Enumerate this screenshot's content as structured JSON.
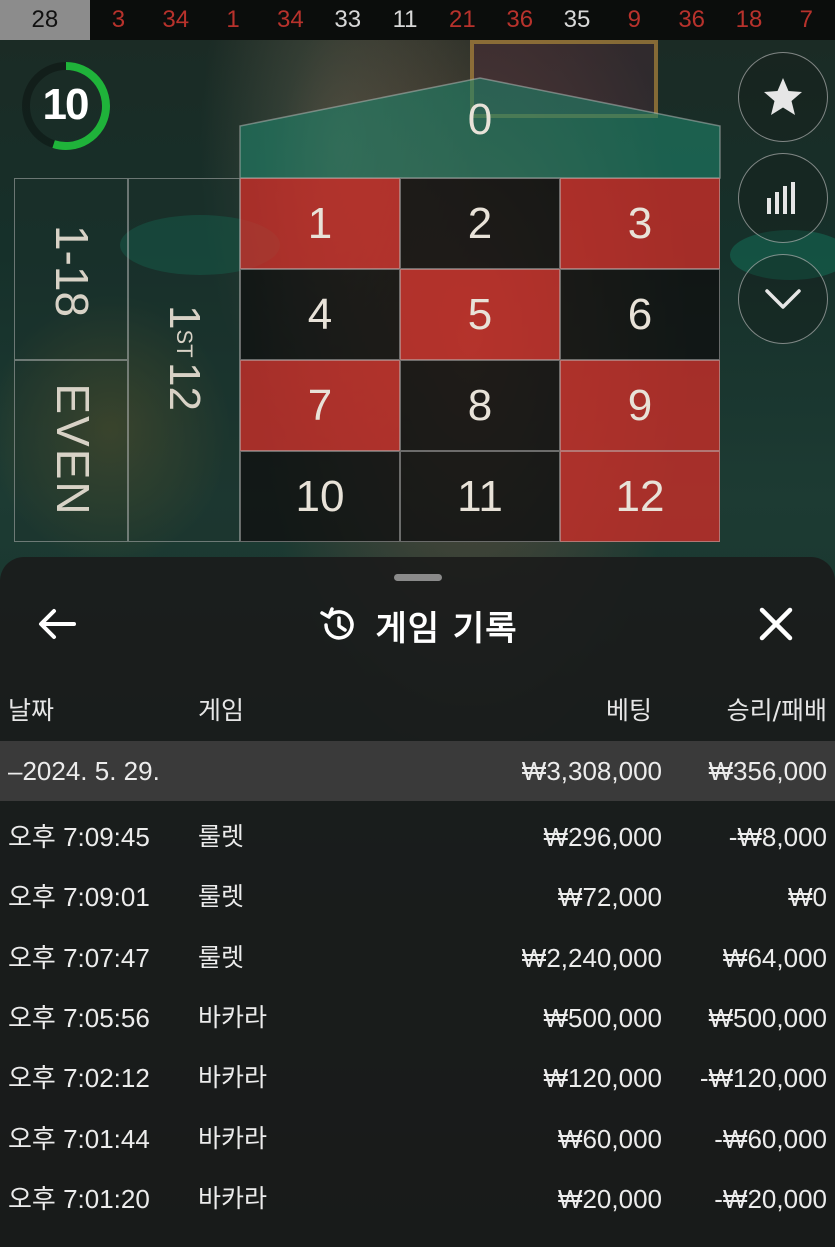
{
  "recent_numbers": [
    {
      "value": "28",
      "color": "highlight"
    },
    {
      "value": "3",
      "color": "red"
    },
    {
      "value": "34",
      "color": "red"
    },
    {
      "value": "1",
      "color": "red"
    },
    {
      "value": "34",
      "color": "red"
    },
    {
      "value": "33",
      "color": "black"
    },
    {
      "value": "11",
      "color": "black"
    },
    {
      "value": "21",
      "color": "red"
    },
    {
      "value": "36",
      "color": "red"
    },
    {
      "value": "35",
      "color": "black"
    },
    {
      "value": "9",
      "color": "red"
    },
    {
      "value": "36",
      "color": "red"
    },
    {
      "value": "18",
      "color": "red"
    },
    {
      "value": "7",
      "color": "red"
    }
  ],
  "timer": {
    "value": "10",
    "ring_color": "#1fb33a",
    "remaining_fraction": 0.55
  },
  "side_buttons": [
    {
      "icon": "star-icon"
    },
    {
      "icon": "statistics-icon"
    },
    {
      "icon": "chevron-down-icon"
    }
  ],
  "board": {
    "zero": "0",
    "rows": [
      [
        {
          "n": "1",
          "c": "red"
        },
        {
          "n": "2",
          "c": "black"
        },
        {
          "n": "3",
          "c": "red"
        }
      ],
      [
        {
          "n": "4",
          "c": "black"
        },
        {
          "n": "5",
          "c": "red"
        },
        {
          "n": "6",
          "c": "black"
        }
      ],
      [
        {
          "n": "7",
          "c": "red"
        },
        {
          "n": "8",
          "c": "black"
        },
        {
          "n": "9",
          "c": "red"
        }
      ],
      [
        {
          "n": "10",
          "c": "black"
        },
        {
          "n": "11",
          "c": "black"
        },
        {
          "n": "12",
          "c": "red"
        }
      ]
    ],
    "outside_1_18": "1-18",
    "outside_even": "EVEN",
    "dozen_ordinal": "1",
    "dozen_suffix": "ST",
    "dozen_number": "12"
  },
  "panel": {
    "title": "게임 기록",
    "columns": {
      "date": "날짜",
      "game": "게임",
      "bet": "베팅",
      "winloss": "승리/패배"
    },
    "summary": {
      "date": "–2024. 5. 29.",
      "bet": "₩3,308,000",
      "winloss": "₩356,000"
    },
    "rows": [
      {
        "time": "오후 7:09:45",
        "game": "룰렛",
        "bet": "₩296,000",
        "winloss": "-₩8,000"
      },
      {
        "time": "오후 7:09:01",
        "game": "룰렛",
        "bet": "₩72,000",
        "winloss": "₩0"
      },
      {
        "time": "오후 7:07:47",
        "game": "룰렛",
        "bet": "₩2,240,000",
        "winloss": "₩64,000"
      },
      {
        "time": "오후 7:05:56",
        "game": "바카라",
        "bet": "₩500,000",
        "winloss": "₩500,000"
      },
      {
        "time": "오후 7:02:12",
        "game": "바카라",
        "bet": "₩120,000",
        "winloss": "-₩120,000"
      },
      {
        "time": "오후 7:01:44",
        "game": "바카라",
        "bet": "₩60,000",
        "winloss": "-₩60,000"
      },
      {
        "time": "오후 7:01:20",
        "game": "바카라",
        "bet": "₩20,000",
        "winloss": "-₩20,000"
      }
    ]
  }
}
